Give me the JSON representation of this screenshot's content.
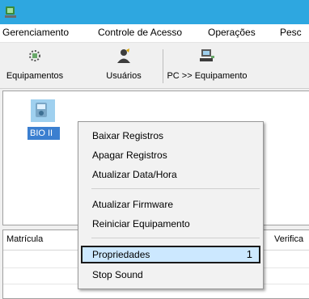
{
  "menubar": {
    "items": [
      "Gerenciamento",
      "Controle de Acesso",
      "Operações",
      "Pesc"
    ]
  },
  "toolbar": {
    "buttons": [
      {
        "label": "Equipamentos",
        "icon": "devices-icon"
      },
      {
        "label": "Usuários",
        "icon": "users-icon"
      },
      {
        "label": "PC >> Equipamento",
        "icon": "pc-to-device-icon"
      }
    ]
  },
  "device_panel": {
    "device_label": "BIO II",
    "icon": "biometric-device-icon"
  },
  "grid": {
    "columns": [
      "Matrícula",
      "Verifica"
    ]
  },
  "context_menu": {
    "items": [
      {
        "label": "Baixar Registros"
      },
      {
        "label": "Apagar Registros"
      },
      {
        "label": "Atualizar Data/Hora"
      },
      {
        "label": "Atualizar Firmware"
      },
      {
        "label": "Reiniciar Equipamento"
      },
      {
        "label": "Propriedades",
        "marker": "1"
      },
      {
        "label": "Stop Sound"
      }
    ]
  },
  "colors": {
    "titlebar": "#2ea7e0",
    "selection": "#cce8ff"
  }
}
